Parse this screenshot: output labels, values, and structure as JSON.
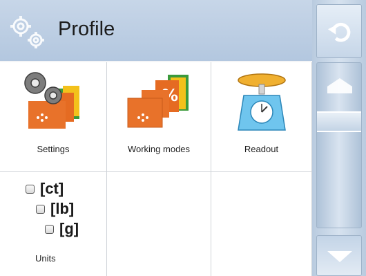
{
  "header": {
    "title": "Profile",
    "icon": "gears-icon"
  },
  "tiles": [
    {
      "label": "Settings",
      "icon": "settings-icon"
    },
    {
      "label": "Working modes",
      "icon": "working-modes-icon"
    },
    {
      "label": "Readout",
      "icon": "scale-icon"
    }
  ],
  "units": {
    "label": "Units",
    "options": [
      {
        "label": "[ct]",
        "checked": false
      },
      {
        "label": "[lb]",
        "checked": false
      },
      {
        "label": "[g]",
        "checked": false
      }
    ]
  },
  "right_panel": {
    "buttons": [
      "undo-icon",
      "home-icon",
      "scroll-handle",
      "arrow-down-icon"
    ]
  },
  "colors": {
    "header": "#b3c7df",
    "accent_orange": "#e8722a",
    "panel": "#c9d8e8"
  }
}
